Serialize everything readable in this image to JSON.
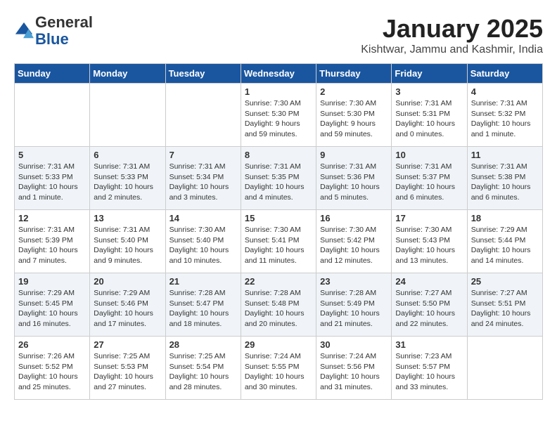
{
  "header": {
    "logo_line1": "General",
    "logo_line2": "Blue",
    "month": "January 2025",
    "location": "Kishtwar, Jammu and Kashmir, India"
  },
  "weekdays": [
    "Sunday",
    "Monday",
    "Tuesday",
    "Wednesday",
    "Thursday",
    "Friday",
    "Saturday"
  ],
  "weeks": [
    [
      {
        "day": "",
        "content": ""
      },
      {
        "day": "",
        "content": ""
      },
      {
        "day": "",
        "content": ""
      },
      {
        "day": "1",
        "content": "Sunrise: 7:30 AM\nSunset: 5:30 PM\nDaylight: 9 hours and 59 minutes."
      },
      {
        "day": "2",
        "content": "Sunrise: 7:30 AM\nSunset: 5:30 PM\nDaylight: 9 hours and 59 minutes."
      },
      {
        "day": "3",
        "content": "Sunrise: 7:31 AM\nSunset: 5:31 PM\nDaylight: 10 hours and 0 minutes."
      },
      {
        "day": "4",
        "content": "Sunrise: 7:31 AM\nSunset: 5:32 PM\nDaylight: 10 hours and 1 minute."
      }
    ],
    [
      {
        "day": "5",
        "content": "Sunrise: 7:31 AM\nSunset: 5:33 PM\nDaylight: 10 hours and 1 minute."
      },
      {
        "day": "6",
        "content": "Sunrise: 7:31 AM\nSunset: 5:33 PM\nDaylight: 10 hours and 2 minutes."
      },
      {
        "day": "7",
        "content": "Sunrise: 7:31 AM\nSunset: 5:34 PM\nDaylight: 10 hours and 3 minutes."
      },
      {
        "day": "8",
        "content": "Sunrise: 7:31 AM\nSunset: 5:35 PM\nDaylight: 10 hours and 4 minutes."
      },
      {
        "day": "9",
        "content": "Sunrise: 7:31 AM\nSunset: 5:36 PM\nDaylight: 10 hours and 5 minutes."
      },
      {
        "day": "10",
        "content": "Sunrise: 7:31 AM\nSunset: 5:37 PM\nDaylight: 10 hours and 6 minutes."
      },
      {
        "day": "11",
        "content": "Sunrise: 7:31 AM\nSunset: 5:38 PM\nDaylight: 10 hours and 6 minutes."
      }
    ],
    [
      {
        "day": "12",
        "content": "Sunrise: 7:31 AM\nSunset: 5:39 PM\nDaylight: 10 hours and 7 minutes."
      },
      {
        "day": "13",
        "content": "Sunrise: 7:31 AM\nSunset: 5:40 PM\nDaylight: 10 hours and 9 minutes."
      },
      {
        "day": "14",
        "content": "Sunrise: 7:30 AM\nSunset: 5:40 PM\nDaylight: 10 hours and 10 minutes."
      },
      {
        "day": "15",
        "content": "Sunrise: 7:30 AM\nSunset: 5:41 PM\nDaylight: 10 hours and 11 minutes."
      },
      {
        "day": "16",
        "content": "Sunrise: 7:30 AM\nSunset: 5:42 PM\nDaylight: 10 hours and 12 minutes."
      },
      {
        "day": "17",
        "content": "Sunrise: 7:30 AM\nSunset: 5:43 PM\nDaylight: 10 hours and 13 minutes."
      },
      {
        "day": "18",
        "content": "Sunrise: 7:29 AM\nSunset: 5:44 PM\nDaylight: 10 hours and 14 minutes."
      }
    ],
    [
      {
        "day": "19",
        "content": "Sunrise: 7:29 AM\nSunset: 5:45 PM\nDaylight: 10 hours and 16 minutes."
      },
      {
        "day": "20",
        "content": "Sunrise: 7:29 AM\nSunset: 5:46 PM\nDaylight: 10 hours and 17 minutes."
      },
      {
        "day": "21",
        "content": "Sunrise: 7:28 AM\nSunset: 5:47 PM\nDaylight: 10 hours and 18 minutes."
      },
      {
        "day": "22",
        "content": "Sunrise: 7:28 AM\nSunset: 5:48 PM\nDaylight: 10 hours and 20 minutes."
      },
      {
        "day": "23",
        "content": "Sunrise: 7:28 AM\nSunset: 5:49 PM\nDaylight: 10 hours and 21 minutes."
      },
      {
        "day": "24",
        "content": "Sunrise: 7:27 AM\nSunset: 5:50 PM\nDaylight: 10 hours and 22 minutes."
      },
      {
        "day": "25",
        "content": "Sunrise: 7:27 AM\nSunset: 5:51 PM\nDaylight: 10 hours and 24 minutes."
      }
    ],
    [
      {
        "day": "26",
        "content": "Sunrise: 7:26 AM\nSunset: 5:52 PM\nDaylight: 10 hours and 25 minutes."
      },
      {
        "day": "27",
        "content": "Sunrise: 7:25 AM\nSunset: 5:53 PM\nDaylight: 10 hours and 27 minutes."
      },
      {
        "day": "28",
        "content": "Sunrise: 7:25 AM\nSunset: 5:54 PM\nDaylight: 10 hours and 28 minutes."
      },
      {
        "day": "29",
        "content": "Sunrise: 7:24 AM\nSunset: 5:55 PM\nDaylight: 10 hours and 30 minutes."
      },
      {
        "day": "30",
        "content": "Sunrise: 7:24 AM\nSunset: 5:56 PM\nDaylight: 10 hours and 31 minutes."
      },
      {
        "day": "31",
        "content": "Sunrise: 7:23 AM\nSunset: 5:57 PM\nDaylight: 10 hours and 33 minutes."
      },
      {
        "day": "",
        "content": ""
      }
    ]
  ]
}
